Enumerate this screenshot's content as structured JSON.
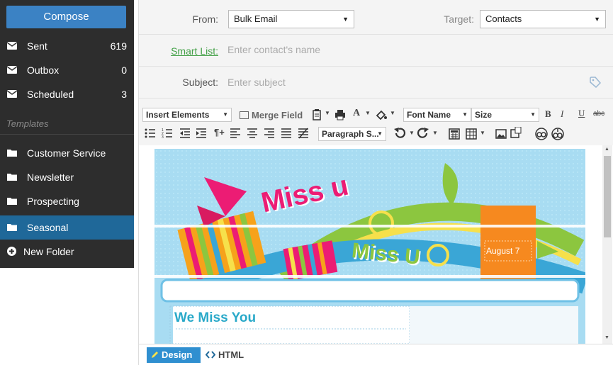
{
  "sidebar": {
    "compose_label": "Compose",
    "folders": [
      {
        "label": "Sent",
        "count": "619",
        "icon": "envelope-icon"
      },
      {
        "label": "Outbox",
        "count": "0",
        "icon": "envelope-icon"
      },
      {
        "label": "Scheduled",
        "count": "3",
        "icon": "envelope-icon"
      }
    ],
    "templates_heading": "Templates",
    "templates": [
      {
        "label": "Customer Service",
        "icon": "folder-icon"
      },
      {
        "label": "Newsletter",
        "icon": "folder-icon"
      },
      {
        "label": "Prospecting",
        "icon": "folder-icon"
      },
      {
        "label": "Seasonal",
        "icon": "folder-icon",
        "active": true
      }
    ],
    "new_folder_label": "New Folder",
    "colors": {
      "background": "#2d2d2d",
      "compose": "#3b82c4",
      "active": "#1f6899"
    }
  },
  "form": {
    "from_label": "From:",
    "from_value": "Bulk Email",
    "target_label": "Target:",
    "target_value": "Contacts",
    "smart_list_label": "Smart List:",
    "smart_list_placeholder": "Enter contact's name",
    "subject_label": "Subject:",
    "subject_placeholder": "Enter subject"
  },
  "toolbar": {
    "insert_elements": "Insert Elements",
    "merge_field": "Merge Field",
    "font_name": "Font Name",
    "size": "Size",
    "paragraph_style": "Paragraph S..."
  },
  "editor": {
    "banner_title_1": "Miss u",
    "banner_title_2": "Miss U",
    "date_badge": "August 7",
    "heading": "We Miss You"
  },
  "view_tabs": {
    "design": "Design",
    "html": "HTML"
  }
}
